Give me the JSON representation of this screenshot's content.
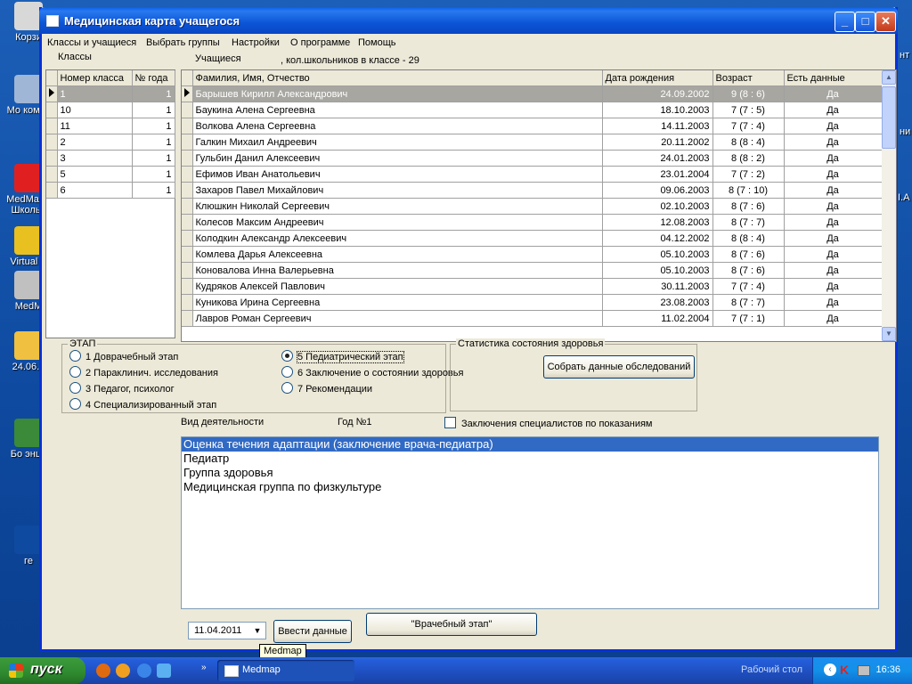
{
  "desktop": {
    "icons": [
      {
        "label": "Корзи",
        "color": "#d8d8d8"
      },
      {
        "label": "Мо компь",
        "color": "#9fb6d6"
      },
      {
        "label": "MedMap - Школьн",
        "color": "#e02020"
      },
      {
        "label": "Virtual S",
        "color": "#e8c020"
      },
      {
        "label": "MedM",
        "color": "#c0c0c0"
      },
      {
        "label": "24.06.2",
        "color": "#f0c040"
      },
      {
        "label": "Бо энци",
        "color": "#3a8a3a"
      },
      {
        "label": "ге",
        "color": "#0e4aa0"
      }
    ],
    "right_labels": [
      "нт",
      "ни",
      "I.A"
    ]
  },
  "window": {
    "title": "Медицинская карта учащегося",
    "buttons": {
      "minimize": "_",
      "maximize": "□",
      "close": "✕"
    }
  },
  "menu": [
    "Классы и учащиеся",
    "Выбрать группы",
    "Настройки",
    "О программе",
    "Помощь"
  ],
  "classes_panel": {
    "label": "Классы",
    "columns": [
      "Номер класса",
      "№ года"
    ],
    "rows": [
      [
        "1",
        "1"
      ],
      [
        "10",
        "1"
      ],
      [
        "11",
        "1"
      ],
      [
        "2",
        "1"
      ],
      [
        "3",
        "1"
      ],
      [
        "5",
        "1"
      ],
      [
        "6",
        "1"
      ]
    ],
    "selected_index": 0
  },
  "students_panel": {
    "label": "Учащиеся",
    "count_text": ", кол.школьников в классе - 29",
    "columns": [
      "Фамилия, Имя, Отчество",
      "Дата рождения",
      "Возраст",
      "Есть данные"
    ],
    "rows": [
      [
        "Барышев Кирилл Александрович",
        "24.09.2002",
        "9 (8 : 6)",
        "Да"
      ],
      [
        "Баукина Алена Сергеевна",
        "18.10.2003",
        "7 (7 : 5)",
        "Да"
      ],
      [
        "Волкова Алена Сергеевна",
        "14.11.2003",
        "7 (7 : 4)",
        "Да"
      ],
      [
        "Галкин Михаил Андреевич",
        "20.11.2002",
        "8 (8 : 4)",
        "Да"
      ],
      [
        "Гульбин Данил Алексеевич",
        "24.01.2003",
        "8 (8 : 2)",
        "Да"
      ],
      [
        "Ефимов Иван Анатольевич",
        "23.01.2004",
        "7 (7 : 2)",
        "Да"
      ],
      [
        "Захаров Павел Михайлович",
        "09.06.2003",
        "8 (7 : 10)",
        "Да"
      ],
      [
        "Клюшкин Николай Сергеевич",
        "02.10.2003",
        "8 (7 : 6)",
        "Да"
      ],
      [
        "Колесов Максим Андреевич",
        "12.08.2003",
        "8 (7 : 7)",
        "Да"
      ],
      [
        "Колодкин Александр Алексеевич",
        "04.12.2002",
        "8 (8 : 4)",
        "Да"
      ],
      [
        "Комлева Дарья Алексеевна",
        "05.10.2003",
        "8 (7 : 6)",
        "Да"
      ],
      [
        "Коновалова Инна Валерьевна",
        "05.10.2003",
        "8 (7 : 6)",
        "Да"
      ],
      [
        "Кудряков Алексей Павлович",
        "30.11.2003",
        "7 (7 : 4)",
        "Да"
      ],
      [
        "Куникова Ирина Сергеевна",
        "23.08.2003",
        "8 (7 : 7)",
        "Да"
      ],
      [
        "Лавров Роман Сергеевич",
        "11.02.2004",
        "7 (7 : 1)",
        "Да"
      ]
    ],
    "selected_index": 0
  },
  "stage_group": {
    "label": "ЭТАП",
    "options": [
      "1 Доврачебный этап",
      "2 Параклинич. исследования",
      "3 Педагог, психолог",
      "4 Специализированный  этап",
      "5 Педиатрический этап",
      "6 Заключение о состоянии здоровья",
      "7 Рекомендации"
    ],
    "selected_index": 4
  },
  "stats_group": {
    "label": "Статистика состояния здоровья",
    "button": "Собрать данные обследований"
  },
  "activity": {
    "label": "Вид деятельности",
    "year": "Год №1",
    "checkbox_label": "Заключения специалистов по показаниям",
    "checked": false
  },
  "activity_list": {
    "items": [
      "Оценка течения адаптации (заключение врача-педиатра)",
      "Педиатр",
      "Группа здоровья",
      "Медицинская группа по физкультуре"
    ],
    "selected_index": 0
  },
  "bottom": {
    "date_value": "11.04.2011",
    "enter_button": "Ввести данные",
    "stage_button": "\"Врачебный этап\"",
    "tooltip": "Medmap"
  },
  "taskbar": {
    "start": "пуск",
    "task_label": "Medmap",
    "desktop_label": "Рабочий стол",
    "clock": "16:36"
  }
}
